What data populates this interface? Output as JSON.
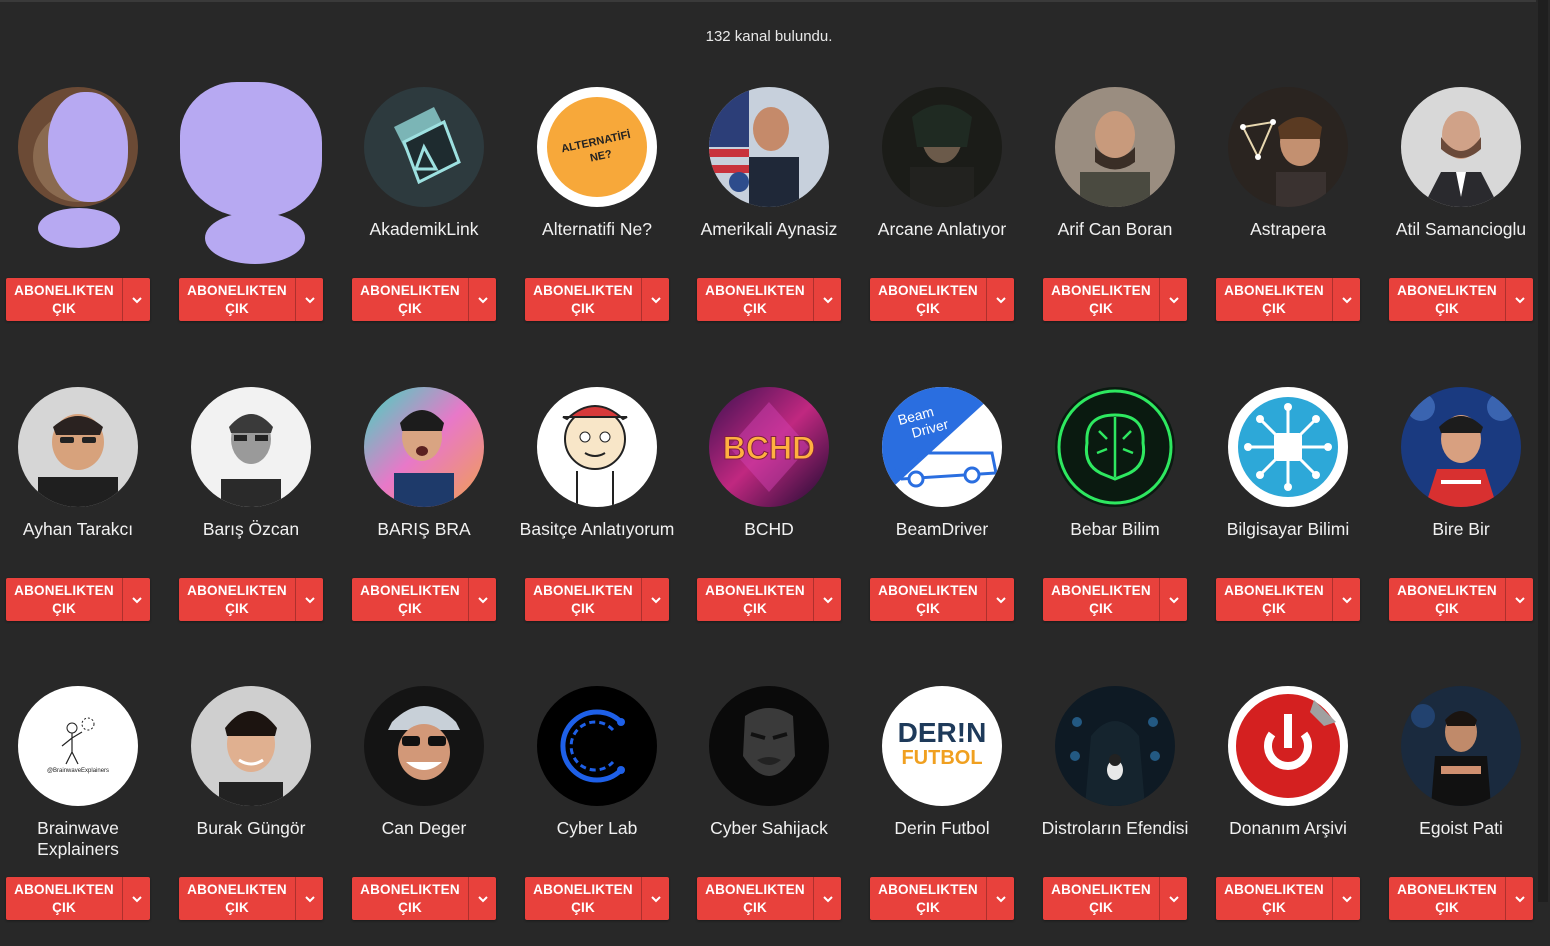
{
  "result_count": "132 kanal bulundu.",
  "unsubscribe_label": "ABONELIKTEN ÇIK",
  "icons": {
    "dropdown": "chevron-down-icon"
  },
  "channels": [
    {
      "name": ""
    },
    {
      "name": ""
    },
    {
      "name": "AkademikLink"
    },
    {
      "name": "Alternatifi Ne?"
    },
    {
      "name": "Amerikali Aynasiz"
    },
    {
      "name": "Arcane Anlatıyor"
    },
    {
      "name": "Arif Can Boran"
    },
    {
      "name": "Astrapera"
    },
    {
      "name": "Atil Samancioglu"
    },
    {
      "name": "Ayhan Tarakcı"
    },
    {
      "name": "Barış Özcan"
    },
    {
      "name": "BARIŞ BRA"
    },
    {
      "name": "Basitçe Anlatıyorum"
    },
    {
      "name": "BCHD"
    },
    {
      "name": "BeamDriver"
    },
    {
      "name": "Bebar Bilim"
    },
    {
      "name": "Bilgisayar Bilimi"
    },
    {
      "name": "Bire Bir"
    },
    {
      "name": "Brainwave Explainers"
    },
    {
      "name": "Burak Güngör"
    },
    {
      "name": "Can Deger"
    },
    {
      "name": "Cyber Lab"
    },
    {
      "name": "Cyber Sahijack"
    },
    {
      "name": "Derin Futbol"
    },
    {
      "name": "Distroların Efendisi"
    },
    {
      "name": "Donanım Arşivi"
    },
    {
      "name": "Egoist Pati"
    }
  ],
  "logo_text": {
    "alternatifi": "ALTERNATİFİ NE?",
    "bchd": "BCHD",
    "beam": "Beam Driver",
    "brainwave": "@BrainwaveExplainers",
    "derin": "DER!N",
    "futbol": "FUTBOL"
  },
  "colors": {
    "background": "#282828",
    "button_red": "#e8413c",
    "redaction": "#b7a9f2"
  }
}
